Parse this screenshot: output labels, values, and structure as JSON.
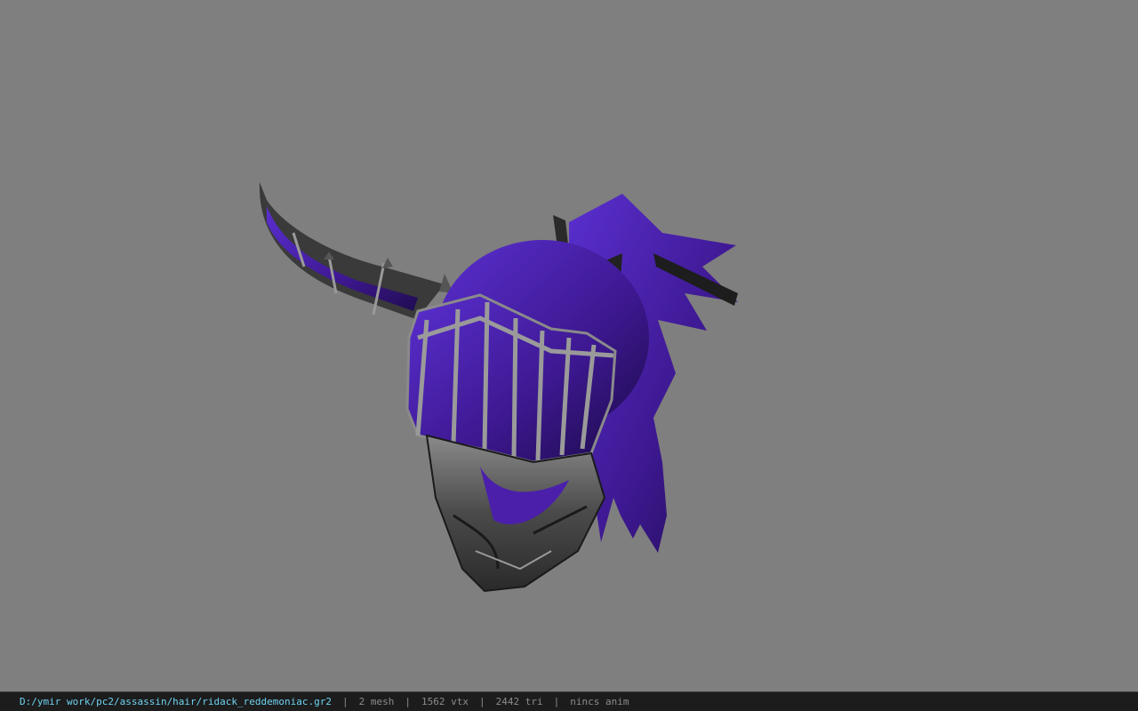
{
  "viewer": {
    "model_description_icon": "helmet-model",
    "background_color": "#7f7f7f"
  },
  "status": {
    "path": "D:/ymir work/pc2/assassin/hair/ridack_reddemoniac.gr2",
    "separator": "|",
    "mesh": "2 mesh",
    "vertices": "1562 vtx",
    "triangles": "2442 tri",
    "anim": "nincs anim"
  },
  "colors": {
    "purple": "#4a1fa8",
    "purple_dark": "#24105a",
    "metal": "#6a6a6a",
    "metal_dark": "#2b2b2b",
    "path_text": "#6fd3f0",
    "status_text": "#8c8c8c"
  }
}
